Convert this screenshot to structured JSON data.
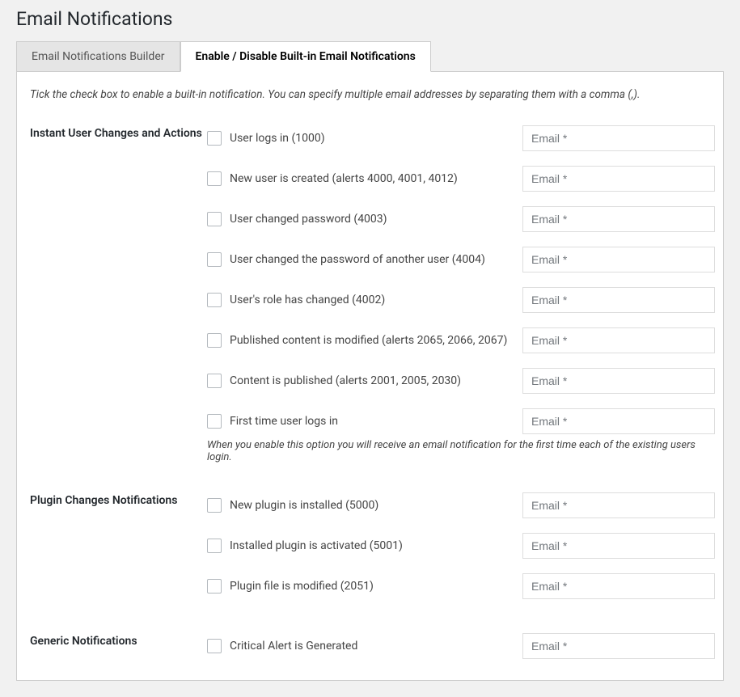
{
  "page_title": "Email Notifications",
  "tabs": {
    "builder": "Email Notifications Builder",
    "enable_disable": "Enable / Disable Built-in Email Notifications"
  },
  "intro": "Tick the check box to enable a built-in notification. You can specify multiple email addresses by separating them with a comma (,).",
  "email_placeholder": "Email *",
  "sections": {
    "instant": {
      "heading": "Instant User Changes and Actions",
      "items": {
        "login": "User logs in (1000)",
        "new_user": "New user is created (alerts 4000, 4001, 4012)",
        "changed_pw": "User changed password (4003)",
        "changed_pw_other": "User changed the password of another user (4004)",
        "role_changed": "User's role has changed (4002)",
        "published_modified": "Published content is modified (alerts 2065, 2066, 2067)",
        "content_published": "Content is published (alerts 2001, 2005, 2030)",
        "first_login": "First time user logs in"
      },
      "first_login_hint": "When you enable this option you will receive an email notification for the first time each of the existing users login."
    },
    "plugin": {
      "heading": "Plugin Changes Notifications",
      "items": {
        "installed": "New plugin is installed (5000)",
        "activated": "Installed plugin is activated (5001)",
        "file_modified": "Plugin file is modified (2051)"
      }
    },
    "generic": {
      "heading": "Generic Notifications",
      "items": {
        "critical": "Critical Alert is Generated"
      }
    }
  }
}
